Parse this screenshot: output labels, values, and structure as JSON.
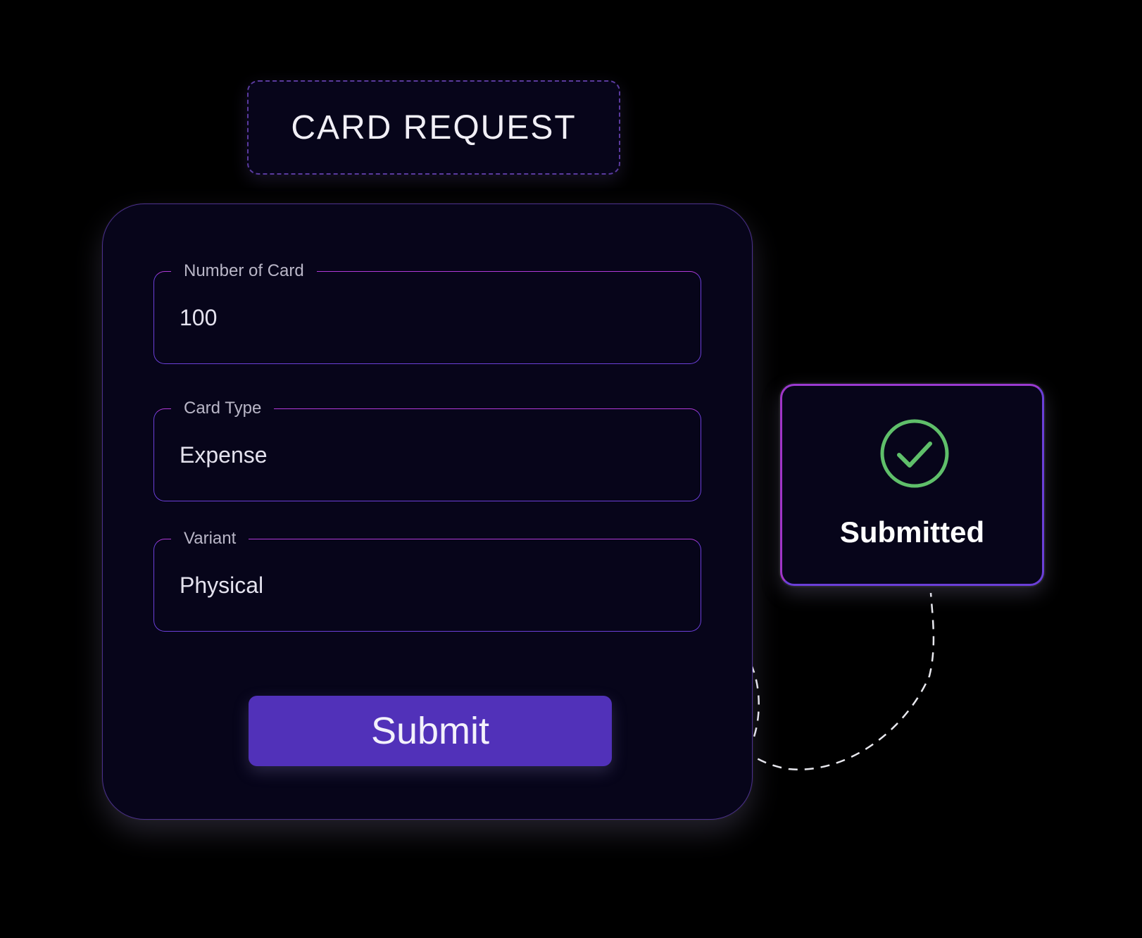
{
  "title": "CARD REQUEST",
  "form": {
    "fields": [
      {
        "label": "Number of Card",
        "value": "100"
      },
      {
        "label": "Card Type",
        "value": "Expense"
      },
      {
        "label": "Variant",
        "value": "Physical"
      }
    ],
    "submit_label": "Submit"
  },
  "status": {
    "label": "Submitted",
    "icon": "check-circle-icon"
  },
  "colors": {
    "background": "#000000",
    "card": "#07051a",
    "accent": "#5131b9",
    "border": "#6b3fd8",
    "border_highlight": "#b03ad8",
    "success": "#5fbf6a"
  }
}
